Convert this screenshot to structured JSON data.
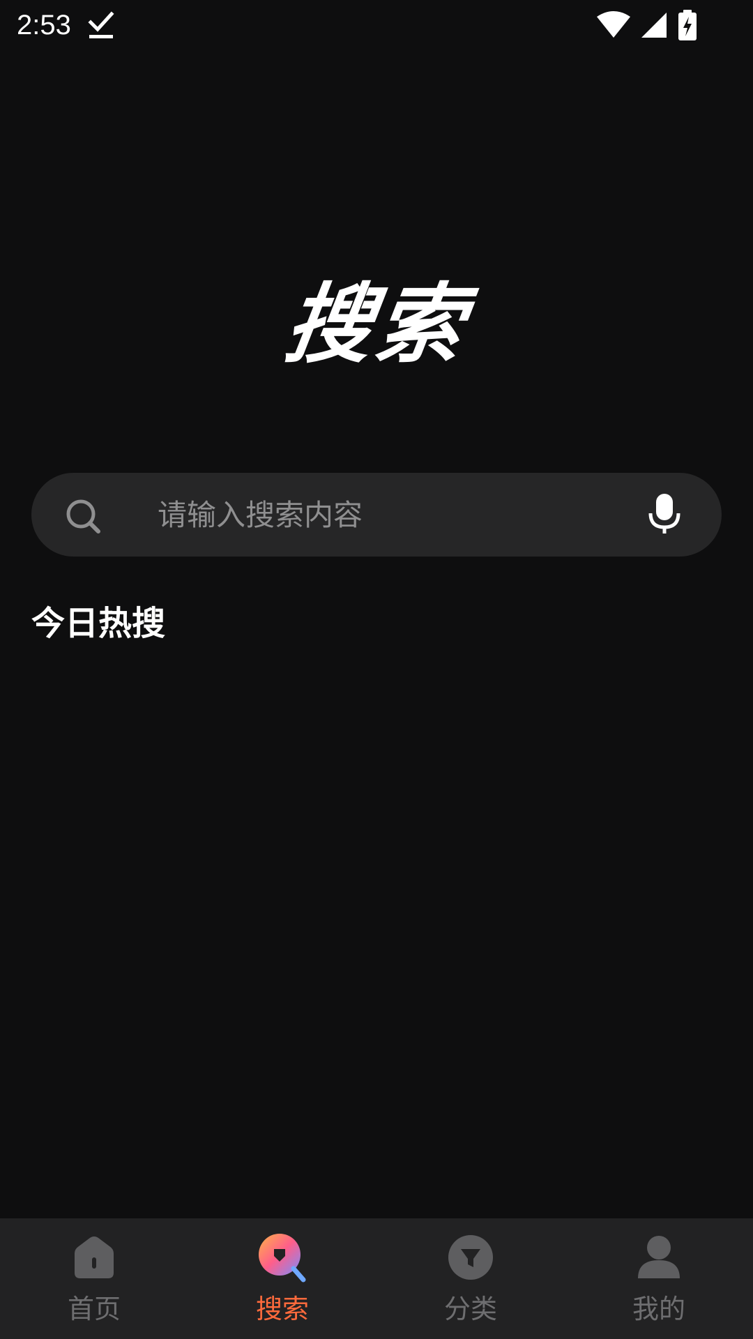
{
  "status_bar": {
    "time": "2:53",
    "icons": [
      "download-done-icon",
      "wifi-icon",
      "cellular-signal-icon",
      "battery-charging-icon"
    ]
  },
  "page": {
    "title": "搜索"
  },
  "search": {
    "placeholder": "请输入搜索内容",
    "value": "",
    "leading_icon": "search-icon",
    "trailing_icon": "microphone-icon"
  },
  "hot_search": {
    "title": "今日热搜",
    "items": []
  },
  "bottom_nav": {
    "items": [
      {
        "label": "首页",
        "icon": "home-icon",
        "active": false
      },
      {
        "label": "搜索",
        "icon": "search-nav-icon",
        "active": true
      },
      {
        "label": "分类",
        "icon": "category-icon",
        "active": false
      },
      {
        "label": "我的",
        "icon": "profile-icon",
        "active": false
      }
    ]
  },
  "colors": {
    "background": "#0e0e0f",
    "search_bar": "#262627",
    "bottom_nav": "#222223",
    "active_tab": "#ff6a3c",
    "inactive_tab": "#6e6e70",
    "placeholder": "#8f8f90"
  }
}
